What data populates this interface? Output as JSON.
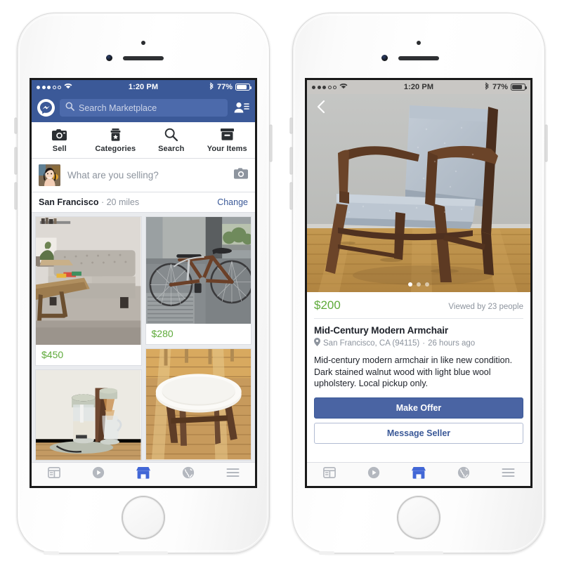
{
  "status_bar": {
    "time": "1:20 PM",
    "battery_percent": "77%",
    "signal_dots_filled": 3,
    "signal_dots_total": 5,
    "wifi_icon": "wifi-icon",
    "bluetooth_icon": "bluetooth-icon",
    "battery_icon": "battery-icon"
  },
  "left_phone": {
    "header": {
      "messenger_icon": "messenger-icon",
      "search_placeholder": "Search Marketplace",
      "search_icon": "search-icon",
      "friend_requests_icon": "friend-requests-icon",
      "background_color": "#3b5998"
    },
    "quick_tabs": [
      {
        "label": "Sell",
        "icon": "camera-icon"
      },
      {
        "label": "Categories",
        "icon": "categories-box-star-icon"
      },
      {
        "label": "Search",
        "icon": "magnifier-icon"
      },
      {
        "label": "Your Items",
        "icon": "archive-box-icon"
      }
    ],
    "composer": {
      "avatar": "user-avatar",
      "prompt": "What are you selling?",
      "camera_icon": "camera-icon"
    },
    "location_row": {
      "pin_icon": "location-pin-icon",
      "city": "San Francisco",
      "separator": "·",
      "radius": "20 miles",
      "change_label": "Change",
      "link_color": "#3b5998"
    },
    "listings": [
      {
        "price": "$450",
        "item": "grey-tufted-sofa",
        "column": 0
      },
      {
        "price": "",
        "item": "coffee-brewer",
        "column": 0
      },
      {
        "price": "$280",
        "item": "road-bicycle",
        "column": 1
      },
      {
        "price": "",
        "item": "white-round-table",
        "column": 1
      }
    ]
  },
  "right_phone": {
    "back_icon": "back-chevron-icon",
    "hero_image": "mid-century-armchair-photo",
    "page_dots": {
      "total": 3,
      "active_index": 0
    },
    "detail": {
      "price": "$200",
      "price_color": "#5eaa3a",
      "views": "Viewed by 23 people",
      "title": "Mid-Century Modern Armchair",
      "pin_icon": "location-pin-icon",
      "location": "San Francisco, CA (94115)",
      "separator": "·",
      "posted": "26 hours ago",
      "description": "Mid-century modern armchair in like new condition. Dark stained walnut wood with light blue wool upholstery. Local pickup only.",
      "make_offer_label": "Make Offer",
      "message_seller_label": "Message Seller",
      "primary_color": "#4a64a3"
    }
  },
  "bottom_nav": [
    {
      "icon": "news-feed-icon",
      "active": false
    },
    {
      "icon": "video-play-icon",
      "active": false
    },
    {
      "icon": "marketplace-store-icon",
      "active": true
    },
    {
      "icon": "notifications-globe-icon",
      "active": false
    },
    {
      "icon": "more-menu-icon",
      "active": false
    }
  ],
  "theme": {
    "facebook_blue": "#3b5998",
    "price_green": "#5eaa3a",
    "grey_text": "#8d949e",
    "dark_text": "#1d2129"
  }
}
